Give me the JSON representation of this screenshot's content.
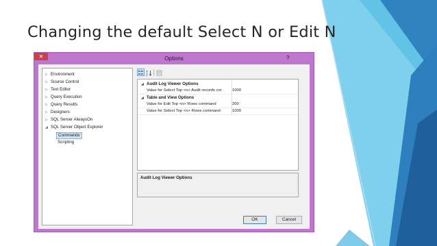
{
  "slide": {
    "title": "Changing the default Select N or Edit N"
  },
  "dialog": {
    "title": "Options",
    "help_label": "?",
    "close_label": "✕",
    "tree": [
      {
        "arrow": "▷",
        "label": "Environment"
      },
      {
        "arrow": "▷",
        "label": "Source Control"
      },
      {
        "arrow": "▷",
        "label": "Text Editor"
      },
      {
        "arrow": "▷",
        "label": "Query Execution"
      },
      {
        "arrow": "▷",
        "label": "Query Results"
      },
      {
        "arrow": "▷",
        "label": "Designers"
      },
      {
        "arrow": "▷",
        "label": "SQL Server AlwaysOn"
      },
      {
        "arrow": "◢",
        "label": "SQL Server Object Explorer"
      }
    ],
    "tree_children": [
      {
        "label": "Commands",
        "selected": true
      },
      {
        "label": "Scripting",
        "selected": false
      }
    ],
    "toolbar": {
      "categorized_icon": "categorized-icon",
      "alphabetical_icon": "alphabetical-sort-icon",
      "pages_icon": "property-pages-icon"
    },
    "grid": {
      "categories": [
        {
          "name": "Audit Log Viewer Options",
          "rows": [
            {
              "name": "Value for Select Top <n> Audit records cor",
              "value": "1000"
            }
          ]
        },
        {
          "name": "Table and View Options",
          "rows": [
            {
              "name": "Value for Edit Top <n> Rows command",
              "value": "200"
            },
            {
              "name": "Value for Select Top <n> Rows command",
              "value": "1000"
            }
          ]
        }
      ]
    },
    "description_title": "Audit Log Viewer Options",
    "ok_label": "OK",
    "cancel_label": "Cancel"
  }
}
